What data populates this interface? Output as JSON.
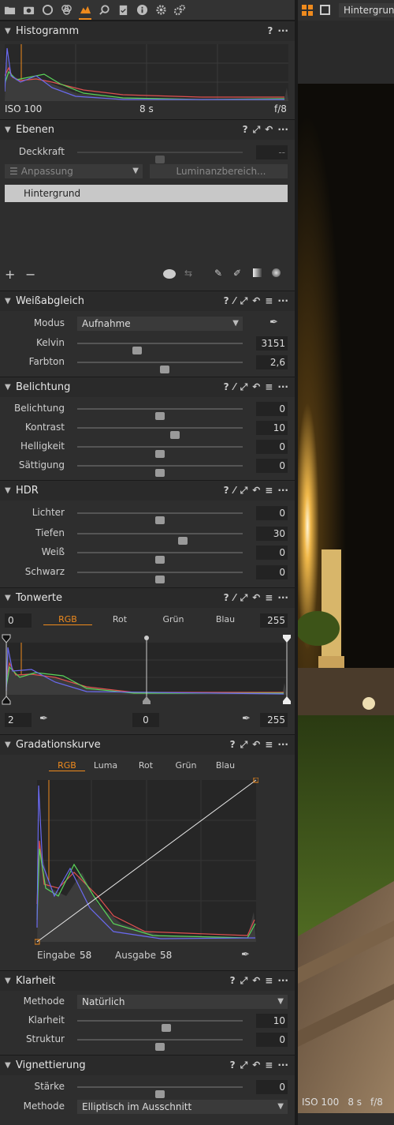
{
  "toptabs": [
    "library-icon",
    "camera-icon",
    "lens-icon",
    "color-icon",
    "exposure-icon",
    "search-icon",
    "metadata-icon",
    "info-icon",
    "settings-icon",
    "adjust-icon"
  ],
  "histogram": {
    "title": "Histogramm",
    "iso": "ISO 100",
    "shutter": "8 s",
    "aperture": "f/8"
  },
  "layers": {
    "title": "Ebenen",
    "opacity_label": "Deckkraft",
    "opacity_value": "--",
    "adjust_dropdown": "Anpassung",
    "luma_button": "Luminanzbereich...",
    "layer_name": "Hintergrund"
  },
  "wb": {
    "title": "Weißabgleich",
    "mode_label": "Modus",
    "mode_value": "Aufnahme",
    "kelvin_label": "Kelvin",
    "kelvin_value": "3151",
    "tint_label": "Farbton",
    "tint_value": "2,6"
  },
  "exposure": {
    "title": "Belichtung",
    "rows": [
      {
        "label": "Belichtung",
        "value": "0"
      },
      {
        "label": "Kontrast",
        "value": "10"
      },
      {
        "label": "Helligkeit",
        "value": "0"
      },
      {
        "label": "Sättigung",
        "value": "0"
      }
    ]
  },
  "hdr": {
    "title": "HDR",
    "rows": [
      {
        "label": "Lichter",
        "value": "0"
      },
      {
        "label": "Tiefen",
        "value": "30"
      },
      {
        "label": "Weiß",
        "value": "0"
      },
      {
        "label": "Schwarz",
        "value": "0"
      }
    ]
  },
  "levels": {
    "title": "Tonwerte",
    "in_low": "0",
    "in_high": "255",
    "tabs": [
      "RGB",
      "Rot",
      "Grün",
      "Blau"
    ],
    "out_low": "2",
    "mid": "0",
    "out_high": "255"
  },
  "curve": {
    "title": "Gradationskurve",
    "tabs": [
      "RGB",
      "Luma",
      "Rot",
      "Grün",
      "Blau"
    ],
    "input_label": "Eingabe",
    "input_value": "58",
    "output_label": "Ausgabe",
    "output_value": "58"
  },
  "clarity": {
    "title": "Klarheit",
    "method_label": "Methode",
    "method_value": "Natürlich",
    "rows": [
      {
        "label": "Klarheit",
        "value": "10"
      },
      {
        "label": "Struktur",
        "value": "0"
      }
    ]
  },
  "vignette": {
    "title": "Vignettierung",
    "strength_label": "Stärke",
    "strength_value": "0",
    "method_label": "Methode",
    "method_value": "Elliptisch im Ausschnitt"
  },
  "viewer": {
    "tab_label": "Hintergrund",
    "iso": "ISO 100",
    "shutter": "8 s",
    "aperture": "f/8"
  },
  "accent": "#ee8a1d"
}
